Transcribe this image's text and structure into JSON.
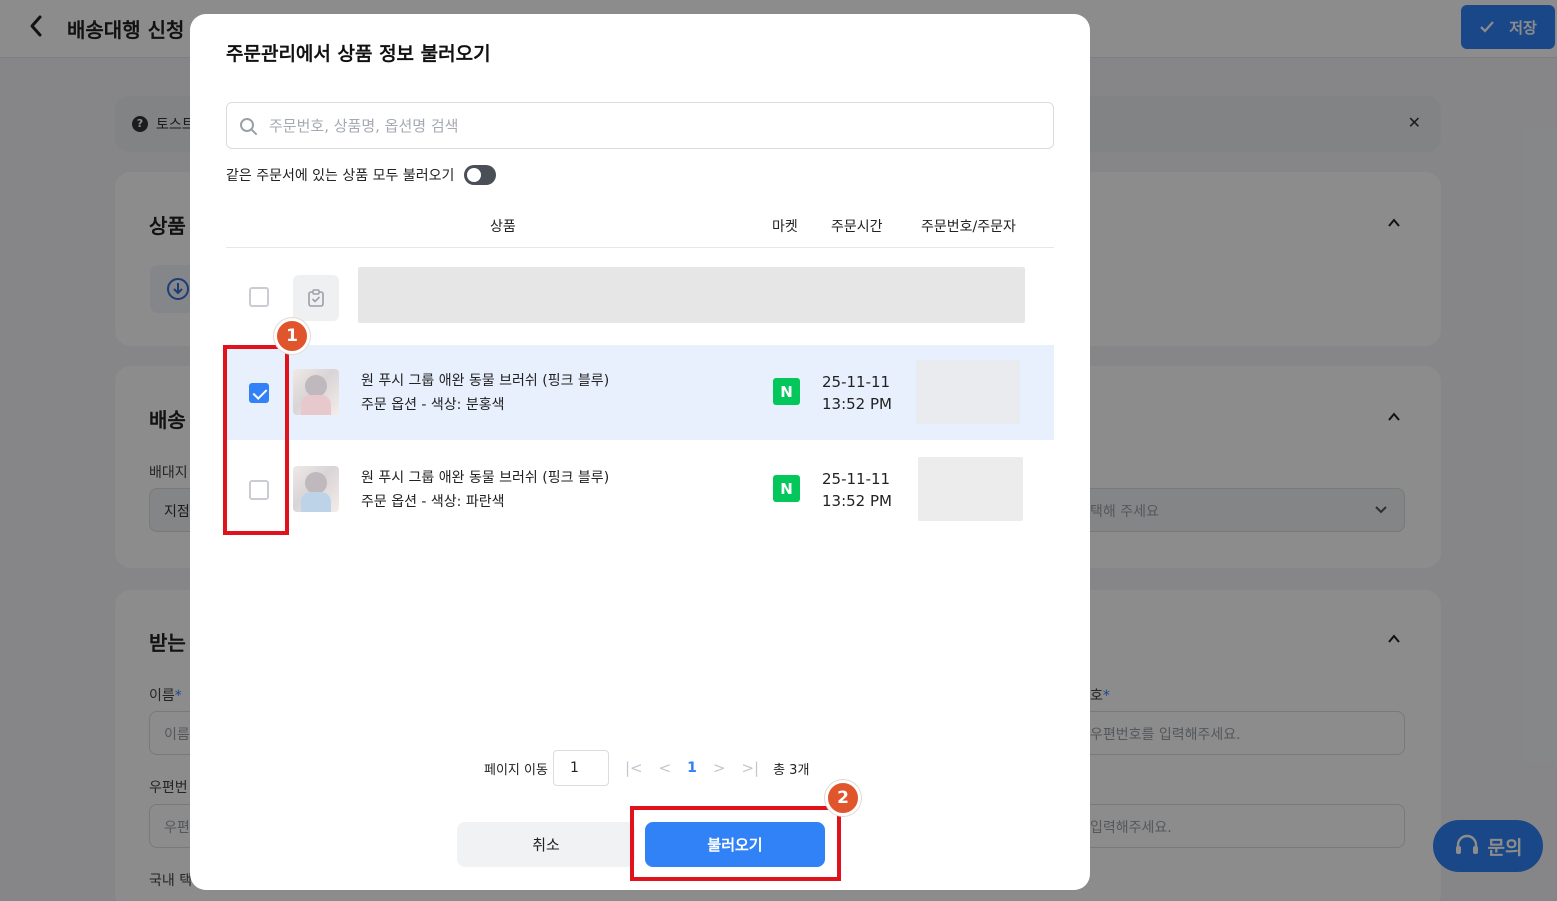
{
  "page": {
    "title": "배송대행 신청",
    "save_label": "저장",
    "notice_text": "토스트",
    "sections": {
      "product_title": "상품",
      "shipping_title": "배송",
      "shipping_field_label": "배대지",
      "shipping_field_value": "지점",
      "shipping_select_placeholder": "택해 주세요",
      "recipient_title": "받는",
      "name_label": "이름",
      "name_placeholder": "이름",
      "phone_label_tail": "호",
      "phone_placeholder": "우편번호를 입력해주세요.",
      "zip_label": "우편번",
      "zip_placeholder": "우편",
      "addr_placeholder": "입력해주세요.",
      "domestic_label": "국내 택"
    },
    "inquiry_label": "문의"
  },
  "modal": {
    "title": "주문관리에서 상품 정보 불러오기",
    "search_placeholder": "주문번호, 상품명, 옵션명 검색",
    "toggle_label": "같은 주문서에 있는 상품 모두 불러오기",
    "toggle_on": false,
    "columns": {
      "product": "상품",
      "market": "마켓",
      "order_time": "주문시간",
      "order_no": "주문번호/주문자"
    },
    "rows": [
      {
        "checked": true,
        "product_name": "원 푸시 그룹 애완 동물 브러쉬 (핑크 블루)",
        "option": "주문 옵션 - 색상: 분홍색",
        "market_icon": "N",
        "date": "25-11-11",
        "time": "13:52 PM"
      },
      {
        "checked": false,
        "product_name": "원 푸시 그룹 애완 동물 브러쉬 (핑크 블루)",
        "option": "주문 옵션 - 색상: 파란색",
        "market_icon": "N",
        "date": "25-11-11",
        "time": "13:52 PM"
      }
    ],
    "pagination": {
      "go_label": "페이지 이동",
      "page_input": "1",
      "current_page": "1",
      "total": "총 3개"
    },
    "cancel_label": "취소",
    "load_label": "불러오기"
  },
  "annotations": {
    "badge1": "1",
    "badge2": "2"
  },
  "colors": {
    "primary": "#3182f6",
    "naver_green": "#03c75a",
    "highlight_red": "#e0121b",
    "badge_orange": "#e0552c",
    "selected_row": "#e8f0fe"
  }
}
